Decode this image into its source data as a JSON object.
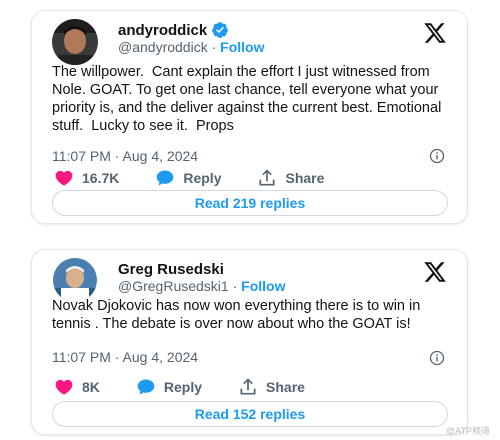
{
  "colors": {
    "accent": "#1d9bf0",
    "like": "#f91880",
    "text": "#0f1419",
    "muted": "#536471",
    "border": "#cfd9de"
  },
  "tweets": [
    {
      "display_name": "andyroddick",
      "verified": true,
      "handle": "@andyroddick",
      "separator": "·",
      "follow_label": "Follow",
      "text": "The willpower.  Cant explain the effort I just witnessed from Nole. GOAT. To get one last chance, tell everyone what your priority is, and the deliver against the current best. Emotional stuff.  Lucky to see it.  Props",
      "timestamp": "11:07 PM · Aug 4, 2024",
      "likes": "16.7K",
      "reply_label": "Reply",
      "share_label": "Share",
      "read_replies_label": "Read 219 replies",
      "icons": [
        "x-logo-icon",
        "verified-badge-icon",
        "info-icon",
        "heart-icon",
        "reply-bubble-icon",
        "share-icon"
      ]
    },
    {
      "display_name": "Greg Rusedski",
      "verified": false,
      "handle": "@GregRusedski1",
      "separator": "·",
      "follow_label": "Follow",
      "text": "Novak Djokovic has now won everything there is to win in tennis . The debate is over now about who the GOAT is!",
      "timestamp": "11:07 PM · Aug 4, 2024",
      "likes": "8K",
      "reply_label": "Reply",
      "share_label": "Share",
      "read_replies_label": "Read 152 replies",
      "icons": [
        "x-logo-icon",
        "info-icon",
        "heart-icon",
        "reply-bubble-icon",
        "share-icon"
      ]
    }
  ],
  "watermark": "@ATP频道 "
}
